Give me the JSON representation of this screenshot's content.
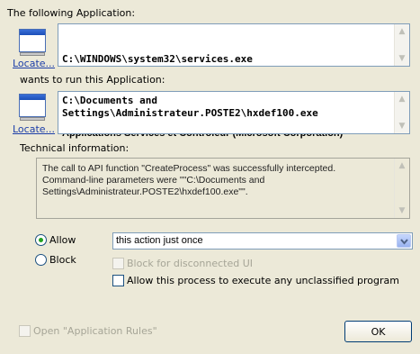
{
  "header": {
    "following_application": "The following Application:"
  },
  "source_app": {
    "locate_label": "Locate...",
    "path": "C:\\WINDOWS\\system32\\services.exe",
    "description": "Applications Services et Contrôleur (Microsoft Corporation)"
  },
  "wants_label": "wants to run this Application:",
  "target_app": {
    "locate_label": "Locate...",
    "path": "C:\\Documents and\nSettings\\Administrateur.POSTE2\\hxdef100.exe"
  },
  "technical": {
    "label": "Technical information:",
    "text": "The call to API function \"CreateProcess\" was successfully intercepted.\nCommand-line parameters were \"\"C:\\Documents and\nSettings\\Administrateur.POSTE2\\hxdef100.exe\"\"."
  },
  "options": {
    "allow_label": "Allow",
    "block_label": "Block",
    "selected": "allow",
    "duration_value": "this action just once",
    "block_disconnected_label": "Block for disconnected UI",
    "allow_unclassified_label": "Allow this process to execute any unclassified program"
  },
  "footer": {
    "open_rules_label": "Open \"Application Rules\"",
    "ok_label": "OK"
  },
  "colors": {
    "background": "#ece9d8",
    "link": "#1c3ea8",
    "radio_dot": "#21a121"
  }
}
